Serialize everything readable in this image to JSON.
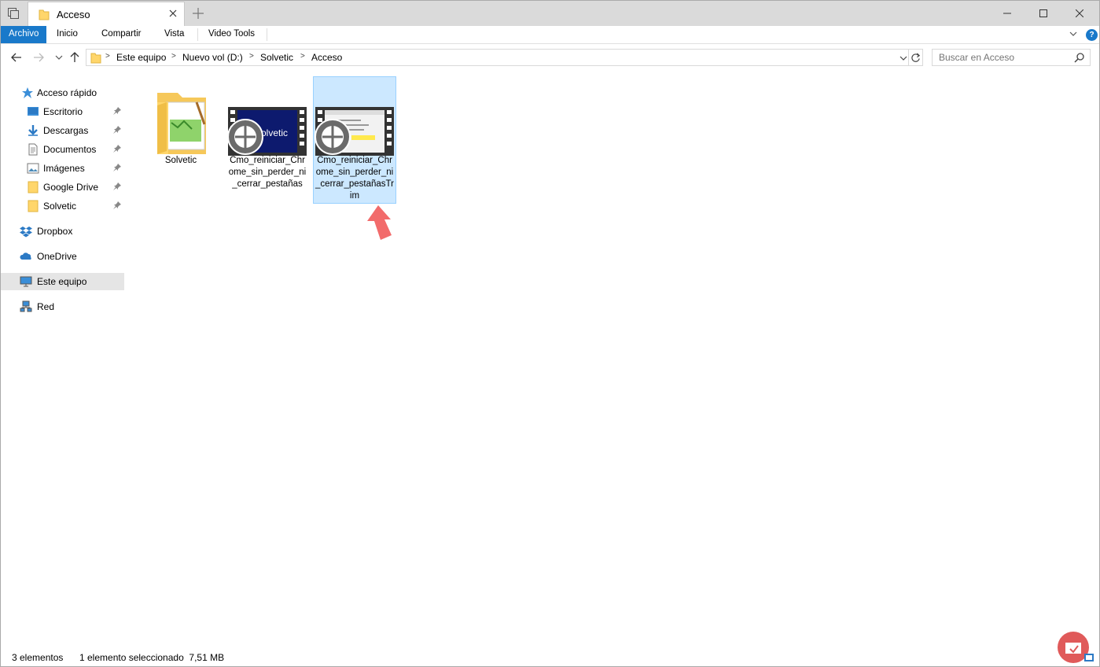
{
  "window": {
    "tab_title": "Acceso"
  },
  "ribbon": {
    "file_tab": "Archivo",
    "tabs": [
      "Inicio",
      "Compartir",
      "Vista",
      "Video Tools"
    ],
    "help": "?"
  },
  "address": {
    "crumbs": [
      "Este equipo",
      "Nuevo vol (D:)",
      "Solvetic",
      "Acceso"
    ]
  },
  "search": {
    "placeholder": "Buscar en Acceso"
  },
  "sidebar": {
    "quick_access": "Acceso rápido",
    "quick_items": [
      {
        "label": "Escritorio",
        "icon": "desktop-icon",
        "pinned": true
      },
      {
        "label": "Descargas",
        "icon": "download-icon",
        "pinned": true
      },
      {
        "label": "Documentos",
        "icon": "document-icon",
        "pinned": true
      },
      {
        "label": "Imágenes",
        "icon": "pictures-icon",
        "pinned": true
      },
      {
        "label": "Google Drive",
        "icon": "folder-icon",
        "pinned": true
      },
      {
        "label": "Solvetic",
        "icon": "folder-icon",
        "pinned": true
      }
    ],
    "dropbox": "Dropbox",
    "onedrive": "OneDrive",
    "this_pc": "Este equipo",
    "network": "Red"
  },
  "files": [
    {
      "name": "Solvetic",
      "type": "folder",
      "selected": false
    },
    {
      "name": "Cmo_reiniciar_Chrome_sin_perder_ni_cerrar_pestañas",
      "type": "video",
      "thumb_text": "olvetic",
      "selected": false
    },
    {
      "name": "Cmo_reiniciar_Chrome_sin_perder_ni_cerrar_pestañasTrim",
      "type": "video",
      "selected": true
    }
  ],
  "status": {
    "count": "3 elementos",
    "selection": "1 elemento seleccionado  7,51 MB"
  },
  "colors": {
    "accent": "#1979ca",
    "selection_bg": "#cce8ff",
    "selection_border": "#99d1ff",
    "arrow": "#f26b6b"
  }
}
